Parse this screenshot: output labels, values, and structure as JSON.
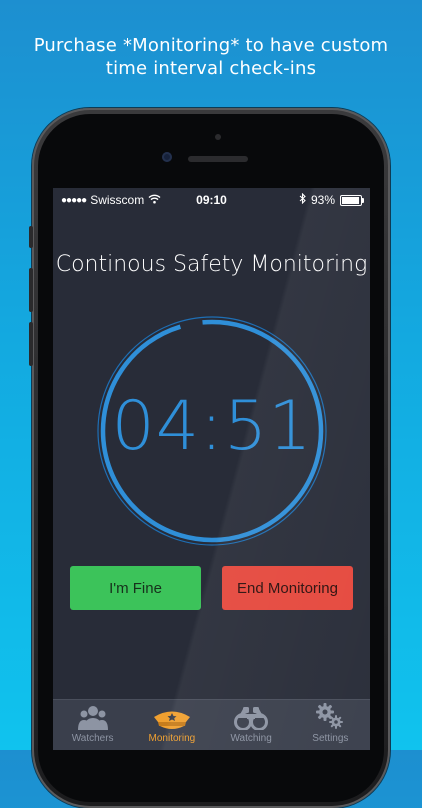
{
  "promo": {
    "line1": "Purchase *Monitoring* to have custom",
    "line2": "time interval check-ins"
  },
  "statusbar": {
    "carrier_dots": "●●●●●",
    "carrier": "Swisscom",
    "time": "09:10",
    "battery": "93%"
  },
  "screen": {
    "title": "Continous Safety Monitoring",
    "timer": "04:51",
    "fine_button": "I'm Fine",
    "end_button": "End Monitoring"
  },
  "tabs": [
    {
      "label": "Watchers",
      "icon": "watchers-icon",
      "active": false
    },
    {
      "label": "Monitoring",
      "icon": "police-cap-icon",
      "active": true
    },
    {
      "label": "Watching",
      "icon": "binoculars-icon",
      "active": false
    },
    {
      "label": "Settings",
      "icon": "gears-icon",
      "active": false
    }
  ],
  "colors": {
    "accent": "#2f8fd8",
    "fine": "#3cc35a",
    "end": "#e5483d",
    "active_tab": "#f0a030"
  }
}
